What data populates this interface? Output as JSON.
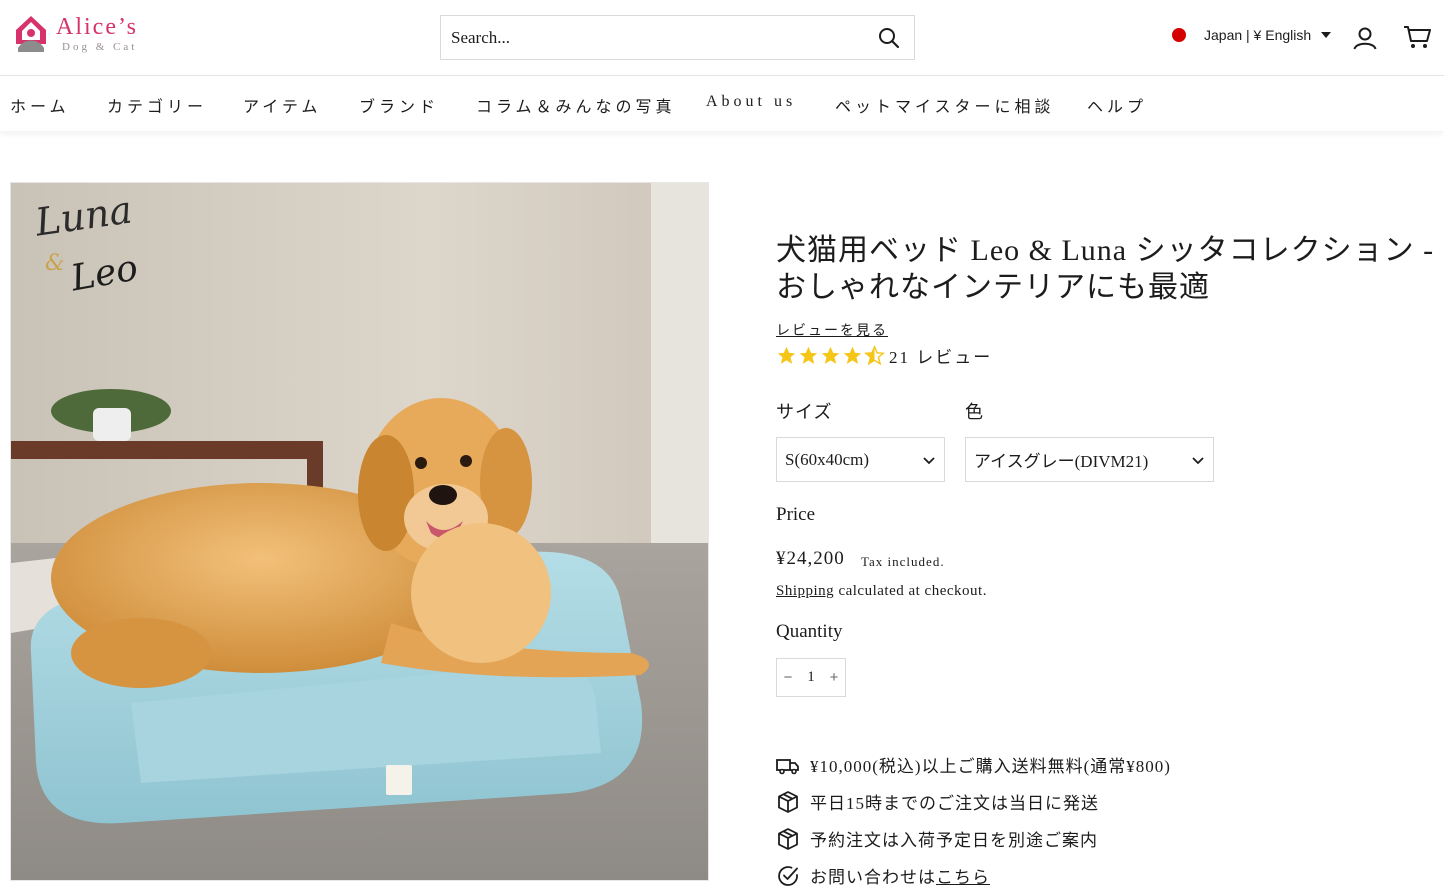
{
  "header": {
    "logo_name": "Alice’s",
    "logo_sub": "Dog & Cat",
    "search_placeholder": "Search...",
    "locale": "Japan | ¥ English"
  },
  "nav": {
    "items": [
      "ホーム",
      "カテゴリー",
      "アイテム",
      "ブランド",
      "コラム＆みんなの写真",
      "About us",
      "ペットマイスターに相談",
      "ヘルプ"
    ]
  },
  "product": {
    "title_line1": "犬猫用ベッド Leo & Luna シッタコレクション -",
    "title_line2": "おしゃれなインテリアにも最適",
    "review_link": "レビューを見る",
    "rating": 4.5,
    "review_count": "21 レビュー",
    "size_label": "サイズ",
    "size_value": "S(60x40cm)",
    "color_label": "色",
    "color_value": "アイスグレー(DIVM21)",
    "price_label": "Price",
    "price": "¥24,200",
    "tax_note": "Tax included.",
    "shipping_link": "Shipping",
    "shipping_rest": " calculated at checkout.",
    "quantity_label": "Quantity",
    "quantity": "1",
    "minus": "−",
    "plus": "+",
    "image_logo_top": "Luna",
    "image_logo_amp": "&",
    "image_logo_bottom": "Leo"
  },
  "features": [
    {
      "icon": "truck-icon",
      "text": "¥10,000(税込)以上ご購入送料無料(通常¥800)"
    },
    {
      "icon": "box-icon",
      "text": "平日15時までのご注文は当日に発送"
    },
    {
      "icon": "box-icon",
      "text": "予約注文は入荷予定日を別途ご案内"
    },
    {
      "icon": "check-circle-icon",
      "text": "お問い合わせは",
      "link": "こちら"
    }
  ],
  "colors": {
    "brand_pink": "#d6336c",
    "star": "#f5c518",
    "bed": "#9ed0dc",
    "dog": "#d9983f"
  }
}
